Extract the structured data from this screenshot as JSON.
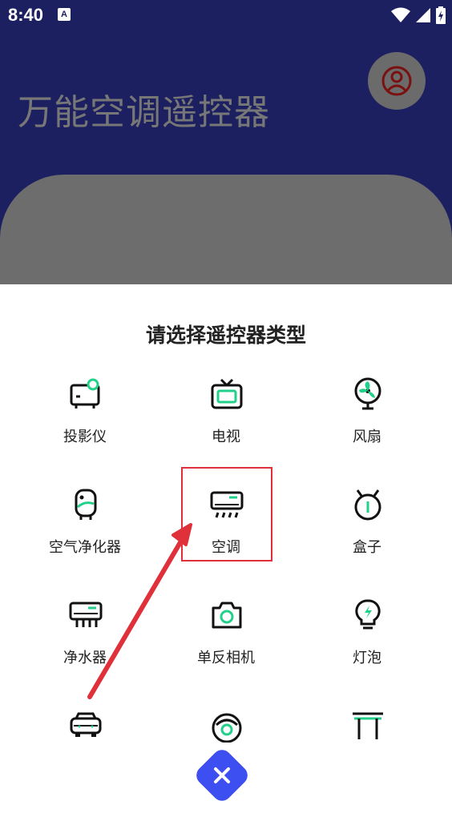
{
  "status_bar": {
    "time": "8:40",
    "a_badge": "A"
  },
  "header": {
    "title": "万能空调遥控器"
  },
  "sheet": {
    "title": "请选择遥控器类型",
    "items": [
      {
        "label": "投影仪",
        "icon": "projector-icon"
      },
      {
        "label": "电视",
        "icon": "tv-icon"
      },
      {
        "label": "风扇",
        "icon": "fan-icon"
      },
      {
        "label": "空气净化器",
        "icon": "air-purifier-icon"
      },
      {
        "label": "空调",
        "icon": "air-conditioner-icon"
      },
      {
        "label": "盒子",
        "icon": "set-top-box-icon"
      },
      {
        "label": "净水器",
        "icon": "water-purifier-icon"
      },
      {
        "label": "单反相机",
        "icon": "camera-icon"
      },
      {
        "label": "灯泡",
        "icon": "light-bulb-icon"
      },
      {
        "label": "",
        "icon": "car-icon"
      },
      {
        "label": "",
        "icon": "robot-vacuum-icon"
      },
      {
        "label": "",
        "icon": "table-icon"
      }
    ]
  },
  "colors": {
    "header_bg": "#1d2060",
    "accent_green": "#22d08a",
    "highlight_red": "#e0303a",
    "close_blue": "#3d4ff0"
  }
}
